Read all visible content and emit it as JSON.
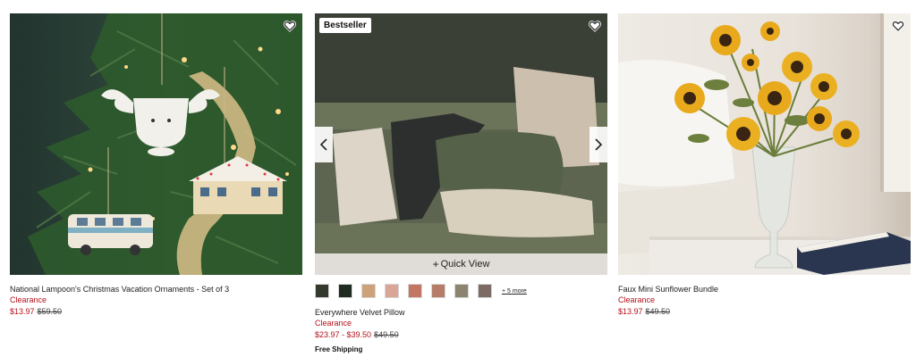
{
  "products": [
    {
      "name": "National Lampoon's Christmas Vacation Ornaments - Set of 3",
      "status": "Clearance",
      "sale_price": "$13.97",
      "original_price": "$59.50",
      "favorite_icon": "heart-outline-icon"
    },
    {
      "badge": "Bestseller",
      "name": "Everywhere Velvet Pillow",
      "status": "Clearance",
      "sale_price": "$23.97 - $39.50",
      "original_price": "$49.50",
      "shipping": "Free Shipping",
      "quick_view": "Quick View",
      "quick_view_icon": "+",
      "more_colors": "+ 5 more",
      "favorite_icon": "heart-outline-icon",
      "swatch_colors": [
        "#33392c",
        "#1f2b20",
        "#cda27a",
        "#d9a596",
        "#c27764",
        "#b77c67",
        "#8d8470",
        "#7c6b62"
      ]
    },
    {
      "name": "Faux Mini Sunflower Bundle",
      "status": "Clearance",
      "sale_price": "$13.97",
      "original_price": "$49.50",
      "favorite_icon": "heart-outline-icon"
    }
  ],
  "colors": {
    "clearance": "#b3121b"
  }
}
